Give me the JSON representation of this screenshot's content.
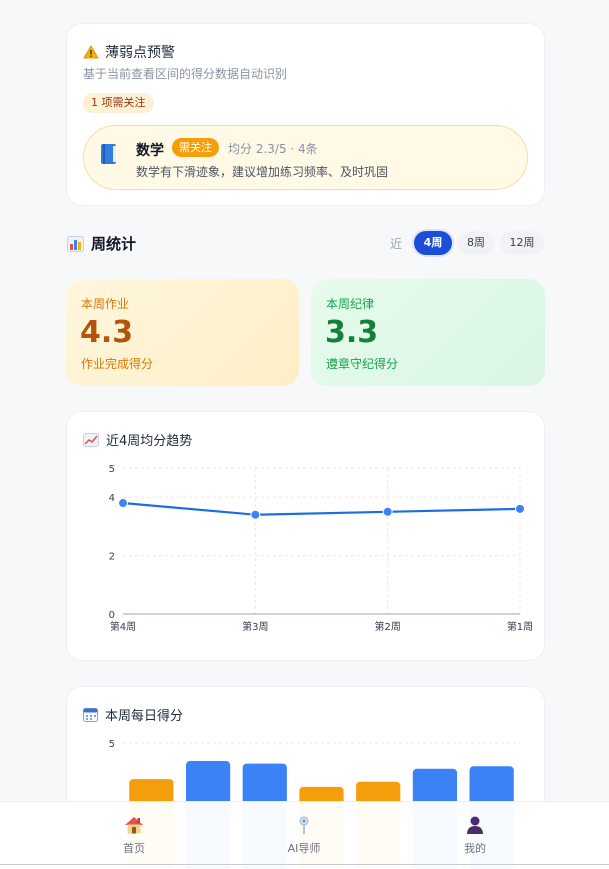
{
  "weak_alert": {
    "title": "薄弱点预警",
    "subtitle": "基于当前查看区间的得分数据自动识别",
    "count_badge": "1 项需关注",
    "items": [
      {
        "subject": "数学",
        "tag": "需关注",
        "meta": "均分 2.3/5 · 4条",
        "description": "数学有下滑迹象，建议增加练习频率、及时巩固"
      }
    ]
  },
  "weekly": {
    "title": "周统计",
    "range_label": "近",
    "ranges": [
      "4周",
      "8周",
      "12周"
    ],
    "selected_range": "4周",
    "homework": {
      "label": "本周作业",
      "value": "4.3",
      "caption": "作业完成得分"
    },
    "discipline": {
      "label": "本周纪律",
      "value": "3.3",
      "caption": "遵章守纪得分"
    }
  },
  "trend_chart_title": "近4周均分趋势",
  "daily_chart_title": "本周每日得分",
  "chart_data": [
    {
      "type": "line",
      "title": "近4周均分趋势",
      "categories": [
        "第4周",
        "第3周",
        "第2周",
        "第1周"
      ],
      "y_ticks": [
        "0",
        "2",
        "4",
        "5"
      ],
      "ylim": [
        0,
        5
      ],
      "grid": true,
      "series": [
        {
          "values": [
            3.8,
            3.4,
            3.5,
            3.6
          ],
          "color": "#1a6fe0"
        }
      ]
    },
    {
      "type": "bar",
      "title": "本周每日得分",
      "y_ticks": [
        "5"
      ],
      "ylim": [
        0,
        5
      ],
      "grid": true,
      "values": [
        3.6,
        4.3,
        4.2,
        3.3,
        3.5,
        4.0,
        4.1
      ],
      "colors": [
        "#f59e0b",
        "#3b82f6",
        "#3b82f6",
        "#f59e0b",
        "#f59e0b",
        "#3b82f6",
        "#3b82f6"
      ]
    }
  ],
  "bottom_nav": [
    {
      "label": "首页",
      "icon": "house-icon"
    },
    {
      "label": "AI导师",
      "icon": "ai-tutor-icon"
    },
    {
      "label": "我的",
      "icon": "user-icon"
    }
  ],
  "colors": {
    "primary": "#1d4ed8",
    "warning": "#f59e0b",
    "success": "#16a34a"
  }
}
